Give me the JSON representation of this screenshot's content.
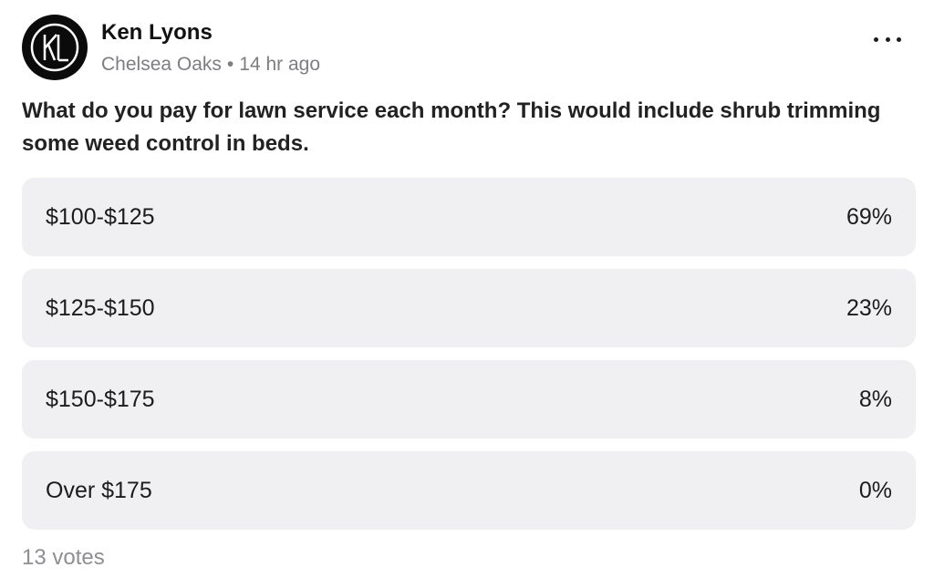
{
  "post": {
    "author": "Ken Lyons",
    "avatar_initials": "KL",
    "neighborhood": "Chelsea Oaks",
    "separator": "•",
    "time": "14 hr ago",
    "more_icon": "more-horizontal-icon",
    "question": "What do you pay for lawn service each month? This would include shrub trimming some weed control in beds."
  },
  "poll": {
    "options": [
      {
        "label": "$100-$125",
        "percent": "69%",
        "share": 0.69
      },
      {
        "label": "$125-$150",
        "percent": "23%",
        "share": 0.23
      },
      {
        "label": "$150-$175",
        "percent": "8%",
        "share": 0.08
      },
      {
        "label": "Over $175",
        "percent": "0%",
        "share": 0.0
      }
    ],
    "votes": "13 votes"
  },
  "colors": {
    "option_background": "#f0f0f2",
    "text": "#1c1c1e",
    "secondary_text": "#7d7d82"
  }
}
